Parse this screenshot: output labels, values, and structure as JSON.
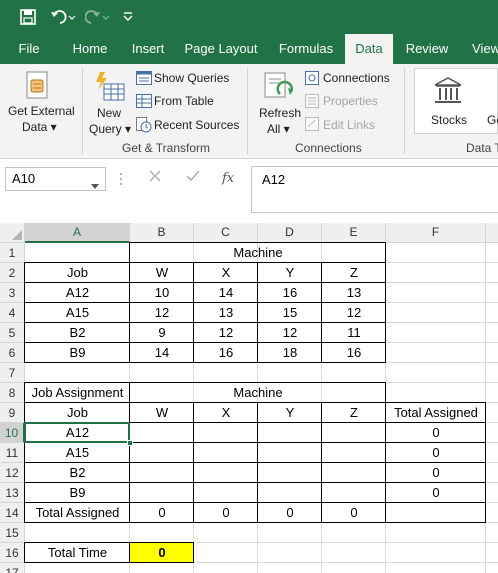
{
  "quick_access": {
    "save": "save-icon",
    "undo": "undo-icon",
    "redo": "redo-icon",
    "customize": "customize-qat-icon"
  },
  "tabs": [
    "File",
    "Home",
    "Insert",
    "Page Layout",
    "Formulas",
    "Data",
    "Review",
    "View"
  ],
  "active_tab": "Data",
  "ribbon": {
    "get_external_1": "Get External",
    "get_external_2": "Data ▾",
    "new_query_1": "New",
    "new_query_2": "Query ▾",
    "show_queries": "Show Queries",
    "from_table": "From Table",
    "recent_sources": "Recent Sources",
    "group_get_transform": "Get & Transform",
    "refresh_1": "Refresh",
    "refresh_2": "All ▾",
    "connections": "Connections",
    "properties": "Properties",
    "edit_links": "Edit Links",
    "group_connections": "Connections",
    "stocks": "Stocks",
    "geography_partial": "Ge",
    "group_data_types": "Data Ty"
  },
  "formula_bar": {
    "name_box": "A10",
    "fx": "fx",
    "content": "A12"
  },
  "columns": [
    "A",
    "B",
    "C",
    "D",
    "E",
    "F"
  ],
  "selected_column": "A",
  "rows": [
    "1",
    "2",
    "3",
    "4",
    "5",
    "6",
    "7",
    "8",
    "9",
    "10",
    "11",
    "12",
    "13",
    "14",
    "15",
    "16",
    "17"
  ],
  "selected_row": "10",
  "sheet": {
    "machine_header_1": "Machine",
    "job_header": "Job",
    "machines": [
      "W",
      "X",
      "Y",
      "Z"
    ],
    "cost_rows": [
      {
        "job": "A12",
        "values": [
          "10",
          "14",
          "16",
          "13"
        ]
      },
      {
        "job": "A15",
        "values": [
          "12",
          "13",
          "15",
          "12"
        ]
      },
      {
        "job": "B2",
        "values": [
          "9",
          "12",
          "12",
          "11"
        ]
      },
      {
        "job": "B9",
        "values": [
          "14",
          "16",
          "18",
          "16"
        ]
      }
    ],
    "job_assignment": "Job Assignment",
    "machine_header_2": "Machine",
    "total_assigned_col": "Total Assigned",
    "assign_rows": [
      {
        "job": "A12",
        "total": "0"
      },
      {
        "job": "A15",
        "total": "0"
      },
      {
        "job": "B2",
        "total": "0"
      },
      {
        "job": "B9",
        "total": "0"
      }
    ],
    "total_assigned_row": "Total Assigned",
    "col_totals": [
      "0",
      "0",
      "0",
      "0"
    ],
    "total_time_label": "Total Time",
    "total_time_value": "0"
  },
  "colors": {
    "brand": "#217346",
    "highlight": "#ffff00"
  }
}
